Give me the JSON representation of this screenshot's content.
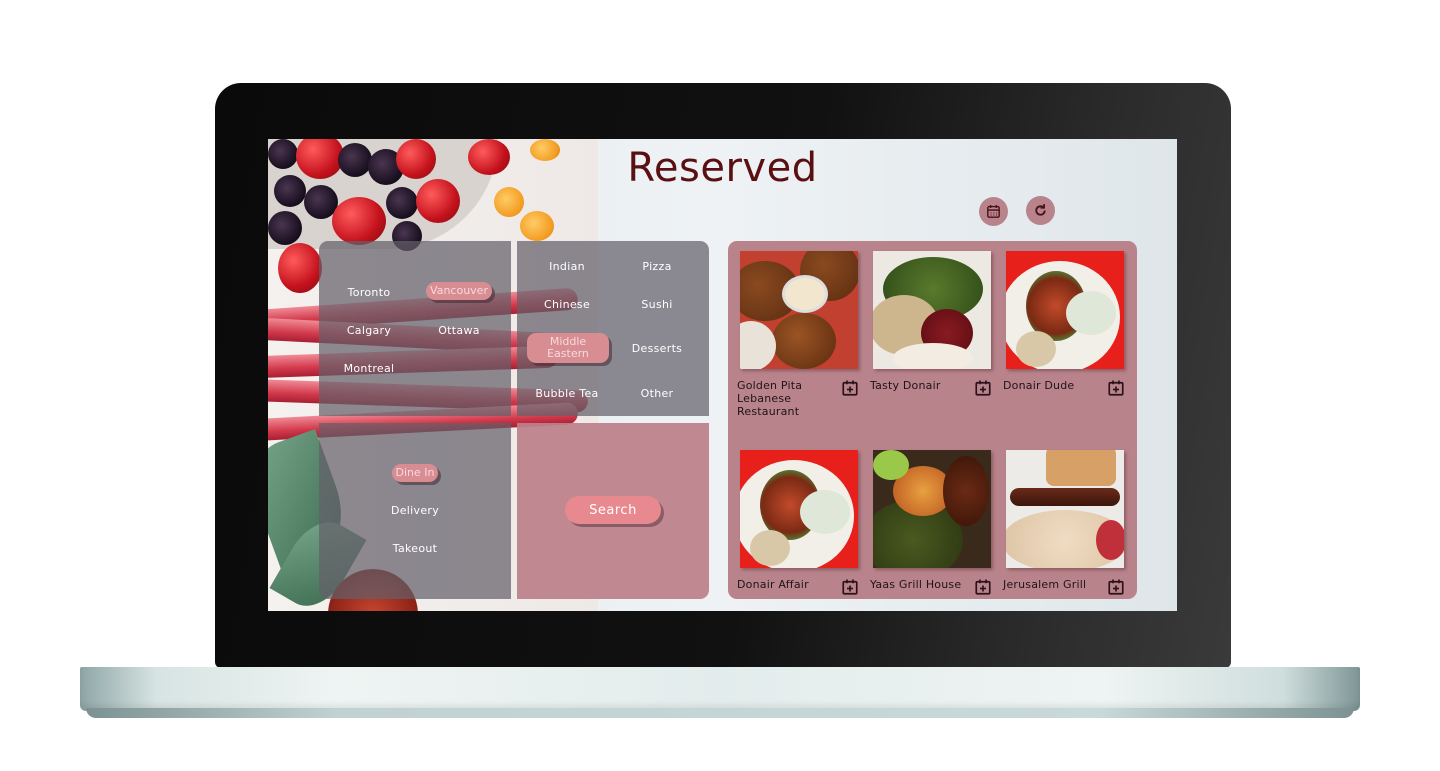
{
  "app": {
    "title": "Reserved",
    "icons": {
      "calendar": "calendar-icon",
      "refresh": "refresh-icon",
      "add_booking": "calendar-plus-icon"
    }
  },
  "filters": {
    "cities": [
      {
        "label": "Toronto",
        "selected": false
      },
      {
        "label": "Vancouver",
        "selected": true
      },
      {
        "label": "Calgary",
        "selected": false
      },
      {
        "label": "Ottawa",
        "selected": false
      },
      {
        "label": "Montreal",
        "selected": false
      }
    ],
    "cuisines": [
      {
        "label": "Indian",
        "selected": false
      },
      {
        "label": "Pizza",
        "selected": false
      },
      {
        "label": "Chinese",
        "selected": false
      },
      {
        "label": "Sushi",
        "selected": false
      },
      {
        "label": "Middle Eastern",
        "selected": true
      },
      {
        "label": "Desserts",
        "selected": false
      },
      {
        "label": "Bubble Tea",
        "selected": false
      },
      {
        "label": "Other",
        "selected": false
      }
    ],
    "service": [
      {
        "label": "Dine In",
        "selected": true
      },
      {
        "label": "Delivery",
        "selected": false
      },
      {
        "label": "Takeout",
        "selected": false
      }
    ],
    "search_label": "Search"
  },
  "results": [
    {
      "name": "Golden Pita Lebanese Restaurant"
    },
    {
      "name": "Tasty Donair"
    },
    {
      "name": "Donair Dude"
    },
    {
      "name": "Donair Affair"
    },
    {
      "name": "Yaas Grill House"
    },
    {
      "name": "Jerusalem Grill"
    }
  ],
  "colors": {
    "title": "#5a0f12",
    "accent_pink": "#b9838b",
    "chip": "#d88d93",
    "search_button": "#e8898f",
    "panel_grey": "#645f69"
  }
}
